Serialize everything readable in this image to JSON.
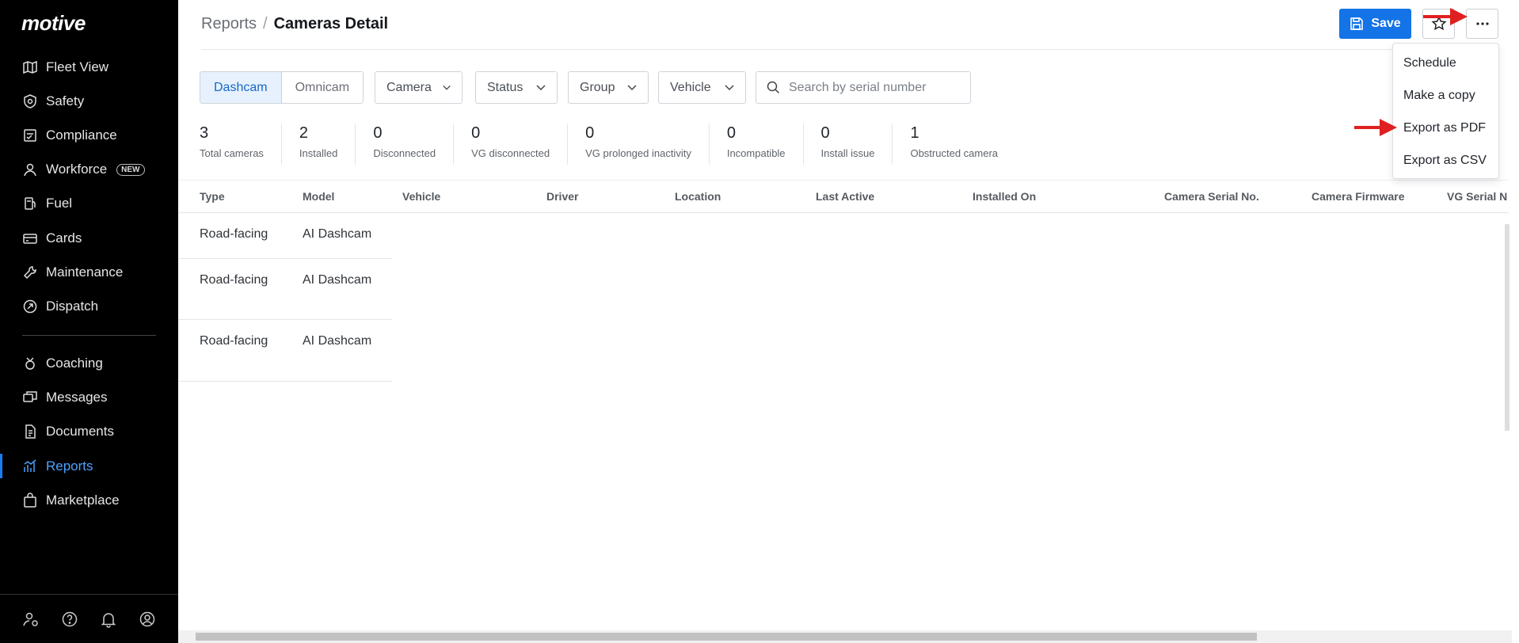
{
  "brand": {
    "logo": "motive",
    "accent": "#1473e6"
  },
  "sidebar": {
    "items": [
      {
        "label": "Fleet View",
        "icon": "map-icon"
      },
      {
        "label": "Safety",
        "icon": "shield-icon"
      },
      {
        "label": "Compliance",
        "icon": "clipboard-icon"
      },
      {
        "label": "Workforce",
        "icon": "person-icon",
        "badge": "NEW"
      },
      {
        "label": "Fuel",
        "icon": "fuel-icon"
      },
      {
        "label": "Cards",
        "icon": "card-icon"
      },
      {
        "label": "Maintenance",
        "icon": "wrench-icon"
      },
      {
        "label": "Dispatch",
        "icon": "dispatch-icon"
      },
      {
        "label": "Coaching",
        "icon": "coaching-icon"
      },
      {
        "label": "Messages",
        "icon": "messages-icon"
      },
      {
        "label": "Documents",
        "icon": "document-icon"
      },
      {
        "label": "Reports",
        "icon": "reports-icon",
        "active": true
      },
      {
        "label": "Marketplace",
        "icon": "bag-icon"
      }
    ],
    "footer_icons": [
      "admin-icon",
      "help-icon",
      "bell-icon",
      "user-icon"
    ]
  },
  "header": {
    "breadcrumb_parent": "Reports",
    "breadcrumb_sep": "/",
    "title": "Cameras Detail",
    "save_label": "Save"
  },
  "menu": {
    "items": [
      "Schedule",
      "Make a copy",
      "Export as PDF",
      "Export as CSV"
    ]
  },
  "filters": {
    "segments": [
      "Dashcam",
      "Omnicam"
    ],
    "active_segment": "Dashcam",
    "dropdowns": [
      "Camera",
      "Status",
      "Group",
      "Vehicle"
    ],
    "search_placeholder": "Search by serial number"
  },
  "stats": [
    {
      "value": "3",
      "label": "Total cameras"
    },
    {
      "value": "2",
      "label": "Installed"
    },
    {
      "value": "0",
      "label": "Disconnected"
    },
    {
      "value": "0",
      "label": "VG disconnected"
    },
    {
      "value": "0",
      "label": "VG prolonged inactivity"
    },
    {
      "value": "0",
      "label": "Incompatible"
    },
    {
      "value": "0",
      "label": "Install issue"
    },
    {
      "value": "1",
      "label": "Obstructed camera"
    }
  ],
  "table": {
    "columns": [
      "Type",
      "Model",
      "Vehicle",
      "Driver",
      "Location",
      "Last Active",
      "Installed On",
      "Camera Serial No.",
      "Camera Firmware",
      "VG Serial N"
    ],
    "rows": [
      [
        "Road-facing",
        "AI Dashcam"
      ],
      [
        "Road-facing",
        "AI Dashcam"
      ],
      [
        "Road-facing",
        "AI Dashcam"
      ]
    ]
  }
}
